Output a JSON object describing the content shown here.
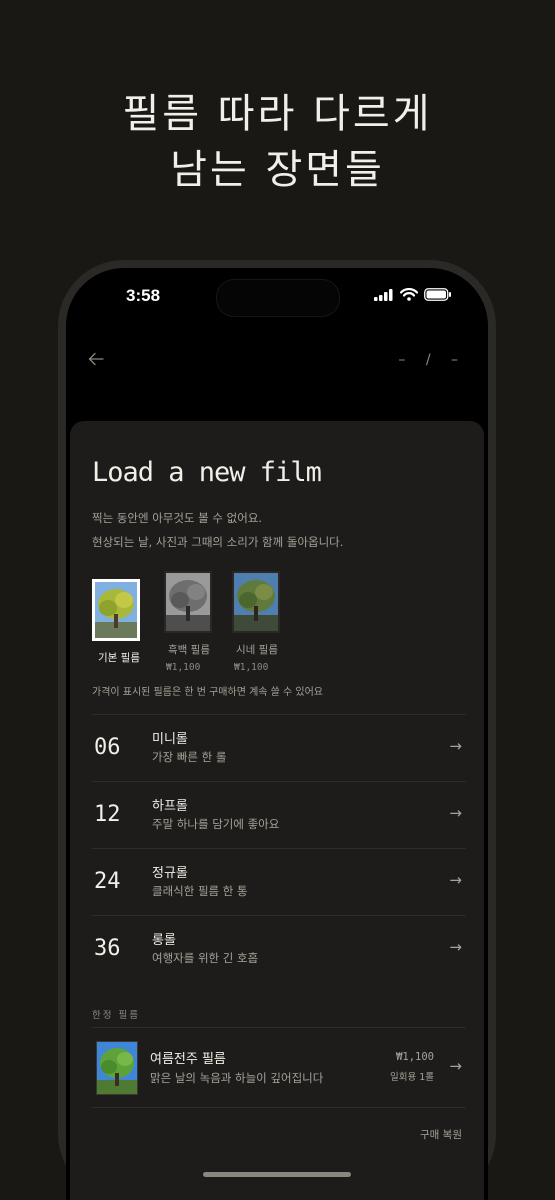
{
  "headline": {
    "line1": "필름 따라 다르게",
    "line2": "남는 장면들"
  },
  "status_bar": {
    "time": "3:58"
  },
  "nav": {
    "back_icon": "arrow-left-icon",
    "page_indicator": "– / –"
  },
  "sheet": {
    "title": "Load a new film",
    "subtitle_line1": "찍는 동안엔 아무것도 볼 수 없어요.",
    "subtitle_line2": "현상되는 날, 사진과 그때의 소리가 함께 돌아옵니다."
  },
  "film_options": [
    {
      "label": "기본 필름",
      "price": "",
      "selected": true
    },
    {
      "label": "흑백 필름",
      "price": "₩1,100",
      "selected": false
    },
    {
      "label": "시네 필름",
      "price": "₩1,100",
      "selected": false
    }
  ],
  "price_note": "가격이 표시된 필름은 한 번 구매하면 계속 쓸 수 있어요",
  "rolls": [
    {
      "count": "06",
      "name": "미니롤",
      "desc": "가장 빠른 한 롤"
    },
    {
      "count": "12",
      "name": "하프롤",
      "desc": "주말 하나를 담기에 좋아요"
    },
    {
      "count": "24",
      "name": "정규롤",
      "desc": "클래식한 필름 한 통"
    },
    {
      "count": "36",
      "name": "롱롤",
      "desc": "여행자를 위한 긴 호흡"
    }
  ],
  "limited": {
    "section_label": "한정 필름",
    "name": "여름전주 필름",
    "desc": "맑은 날의 녹음과 하늘이 깊어집니다",
    "price": "₩1,100",
    "price_sub": "일회용 1롤"
  },
  "restore_label": "구매 복원",
  "row_arrow": "→",
  "colors": {
    "background": "#1a1815",
    "sheet": "#1d1c1a",
    "text": "#f2efe8",
    "muted": "#a6a198"
  }
}
